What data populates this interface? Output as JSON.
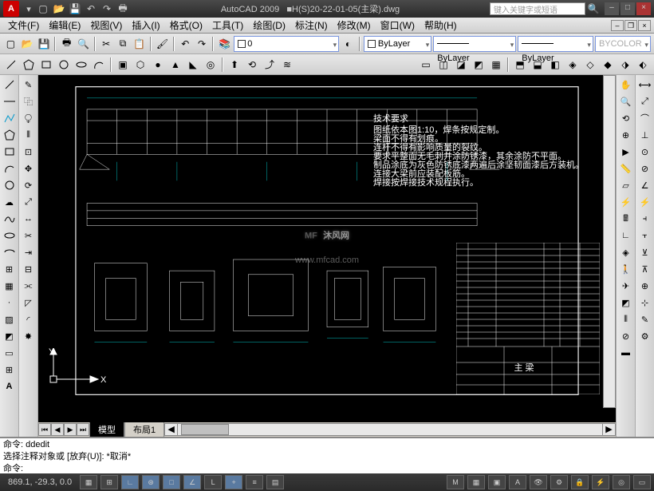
{
  "app": {
    "name": "AutoCAD 2009",
    "filename": "■H(S)20-22-01-05(主梁).dwg",
    "search_placeholder": "键入关键字或短语"
  },
  "menu": {
    "file": "文件(F)",
    "edit": "编辑(E)",
    "view": "视图(V)",
    "insert": "插入(I)",
    "format": "格式(O)",
    "tools": "工具(T)",
    "draw": "绘图(D)",
    "dimension": "标注(N)",
    "modify": "修改(M)",
    "window": "窗口(W)",
    "help": "帮助(H)"
  },
  "layer": {
    "current": "0",
    "color_control": "ByLayer",
    "linetype_control": "ByLayer",
    "lineweight_control": "ByLayer",
    "plotstyle_control": "BYCOLOR"
  },
  "tabs": {
    "model": "模型",
    "layout1": "布局1"
  },
  "command": {
    "line1": "命令:  ddedit",
    "line2": "选择注释对象或 [放弃(U)]: *取消*",
    "prompt": "命令:"
  },
  "status": {
    "coords": "869.1, -29.3, 0.0"
  },
  "tech_req": {
    "title": "技术要求",
    "l1": "图纸依本图1:10，焊条按规定制。",
    "l2": "梁面不得有划痕。",
    "l3": "连杆不得有影响质量的裂纹。",
    "l4": "要求平整面无毛刺并涂防锈漆，其余涂防不平面。",
    "l5": "制品涂底为灰色防锈底漆两遍后涂坚韧面漆后方装机。",
    "l6": "连接大梁前应装配板筋。",
    "l7": "焊接按焊接技术规程执行。"
  },
  "titleblock_label": "主 梁",
  "watermark": "沐风网",
  "watermark_url": "www.mfcad.com"
}
